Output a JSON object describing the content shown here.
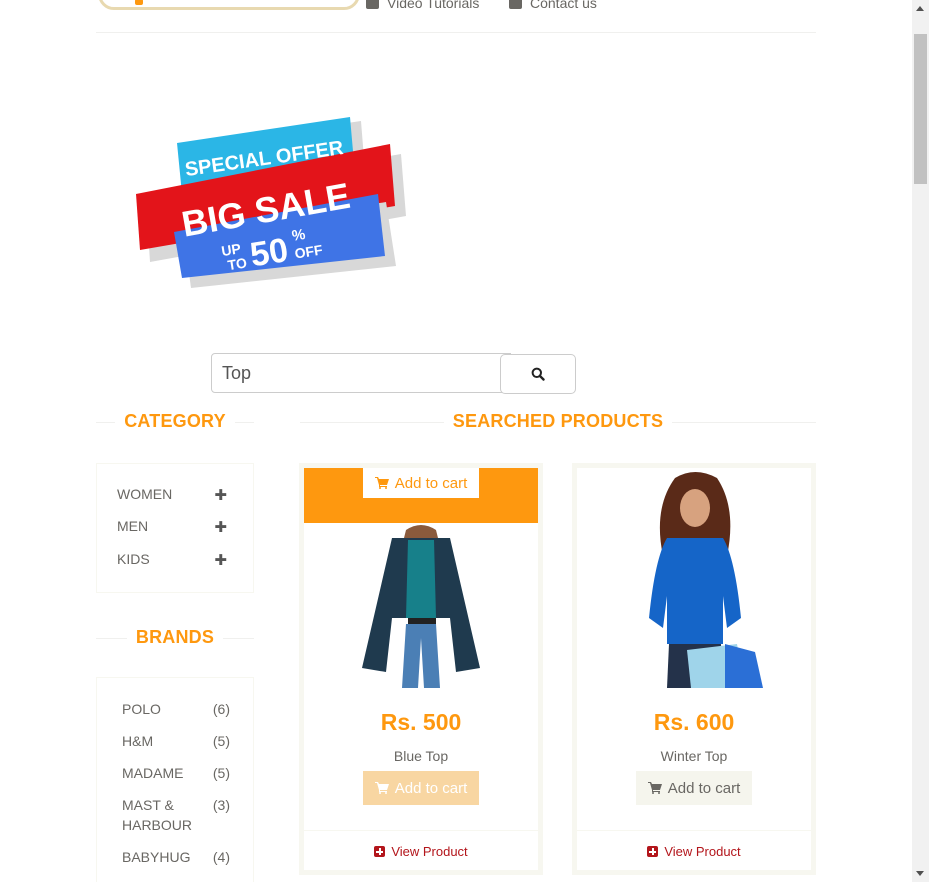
{
  "header": {
    "links": [
      {
        "label": "Video Tutorials",
        "icon": "youtube-icon"
      },
      {
        "label": "Contact us",
        "icon": "envelope-icon"
      }
    ]
  },
  "banner": {
    "line1": "SPECIAL OFFER",
    "line2": "BIG SALE",
    "up": "UP",
    "to": "TO",
    "percent": "50",
    "pct_sign": "%",
    "off": "OFF"
  },
  "search": {
    "value": "Top",
    "icon": "search-icon"
  },
  "sidebar": {
    "category_title": "CATEGORY",
    "categories": [
      {
        "label": "WOMEN"
      },
      {
        "label": "MEN"
      },
      {
        "label": "KIDS"
      }
    ],
    "brands_title": "BRANDS",
    "brands": [
      {
        "label": "POLO",
        "count": "(6)"
      },
      {
        "label": "H&M",
        "count": "(5)"
      },
      {
        "label": "MADAME",
        "count": "(5)"
      },
      {
        "label": "MAST & HARBOUR",
        "count": "(3)"
      },
      {
        "label": "BABYHUG",
        "count": "(4)"
      }
    ]
  },
  "products_title": "SEARCHED PRODUCTS",
  "products": [
    {
      "price": "Rs. 500",
      "name": "Blue Top",
      "add_label": "Add to cart",
      "overlay_label": "Add to cart",
      "view_label": "View Product"
    },
    {
      "price": "Rs. 600",
      "name": "Winter Top",
      "add_label": "Add to cart",
      "view_label": "View Product"
    }
  ],
  "colors": {
    "accent": "#fe980f",
    "view_link": "#b3151b",
    "text": "#696763"
  }
}
